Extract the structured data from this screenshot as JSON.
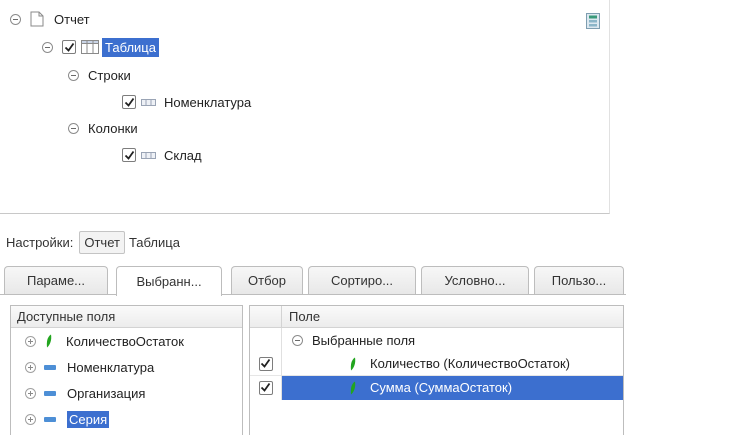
{
  "structure": {
    "root": {
      "label": "Отчет"
    },
    "table": {
      "label": "Таблица"
    },
    "rows": {
      "label": "Строки",
      "item": "Номенклатура"
    },
    "columns": {
      "label": "Колонки",
      "item": "Склад"
    }
  },
  "settings": {
    "label": "Настройки:",
    "options": [
      "Отчет",
      "Таблица"
    ]
  },
  "tabs": [
    "Параме...",
    "Выбранн...",
    "Отбор",
    "Сортиро...",
    "Условно...",
    "Пользо..."
  ],
  "available_fields": {
    "header": "Доступные поля",
    "items": [
      "КоличествоОстаток",
      "Номенклатура",
      "Организация",
      "Серия"
    ]
  },
  "selected_fields": {
    "header": "Поле",
    "group": "Выбранные поля",
    "items": [
      "Количество (КоличествоОстаток)",
      "Сумма (СуммаОстаток)"
    ]
  },
  "colors": {
    "selection": "#3c6fcf",
    "field_leaf": "#22a51f"
  }
}
